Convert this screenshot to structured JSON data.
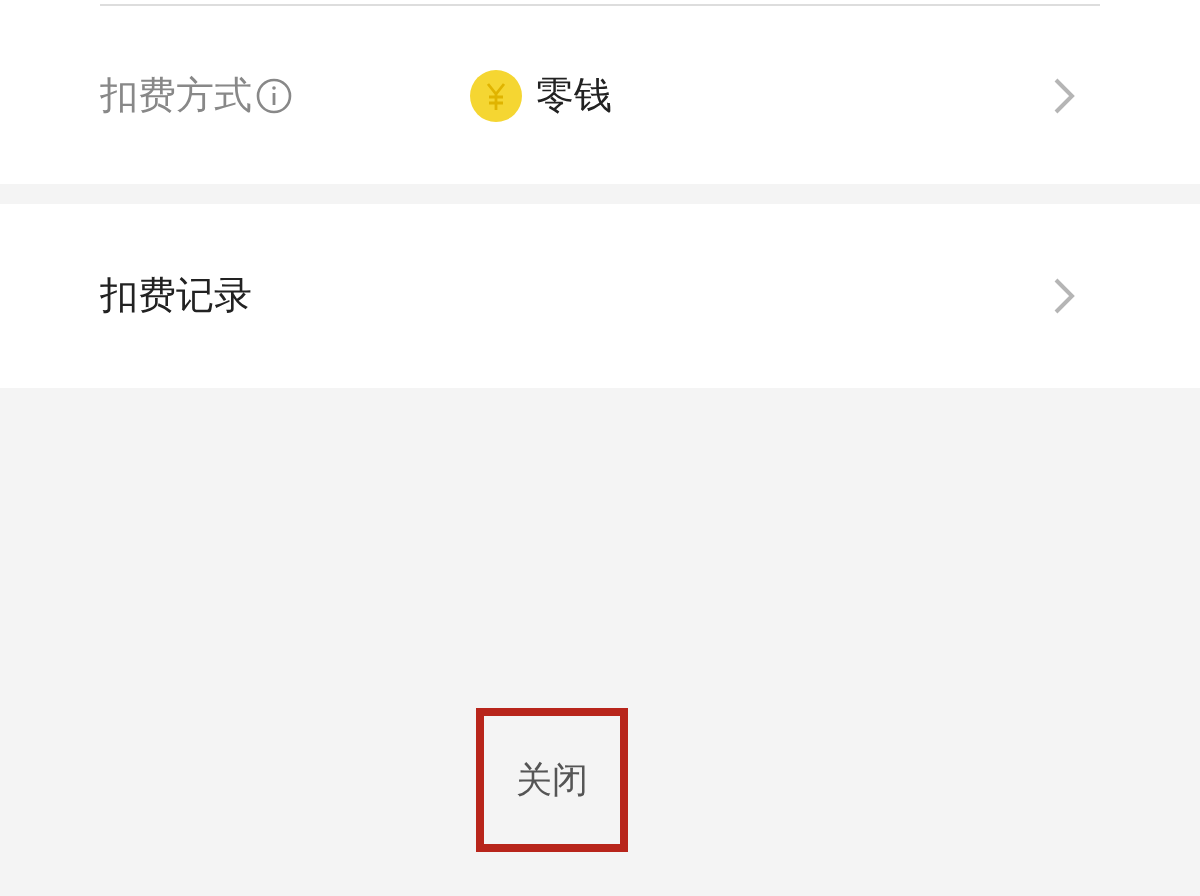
{
  "rows": [
    {
      "label": "扣费方式",
      "kind": "info",
      "value": "零钱"
    },
    {
      "label": "扣费记录",
      "kind": "plain"
    }
  ],
  "close_button": {
    "label": "关闭",
    "highlighted": true
  }
}
